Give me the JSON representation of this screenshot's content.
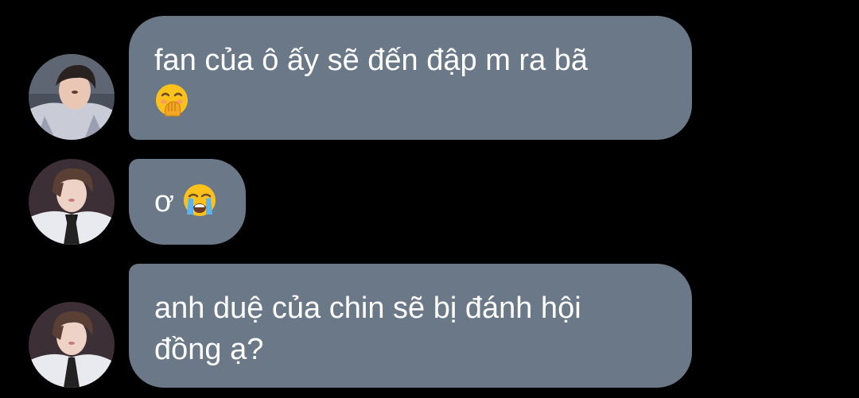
{
  "messages": [
    {
      "avatar_icon": "profile-photo-icon",
      "lines": [
        "fan của ô ấy sẽ đến đập m ra bã"
      ],
      "emoji": "hand-over-mouth-emoji"
    },
    {
      "avatar_icon": "profile-photo-icon",
      "lines": [
        "ơ"
      ],
      "emoji": "loudly-crying-face-emoji"
    },
    {
      "avatar_icon": "profile-photo-icon",
      "lines": [
        "anh duệ của chin sẽ bị đánh hội",
        "đồng ạ?"
      ]
    }
  ],
  "colors": {
    "background": "#000000",
    "bubble": "#6a7887",
    "text": "#ffffff"
  }
}
